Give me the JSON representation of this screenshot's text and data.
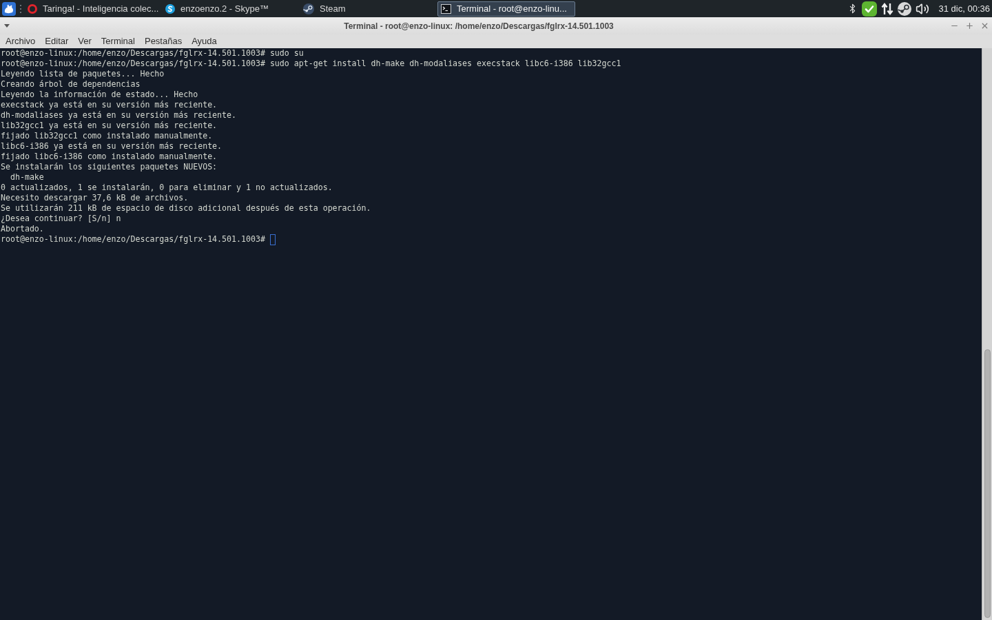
{
  "taskbar": {
    "windows": [
      {
        "label": "Taringa! - Inteligencia colec...",
        "selected": false
      },
      {
        "label": "enzoenzo.2 - Skype™",
        "selected": false
      },
      {
        "label": "Steam",
        "selected": false
      },
      {
        "label": "Terminal - root@enzo-linu...",
        "selected": true
      }
    ],
    "clock": "31 dic, 00:36"
  },
  "window": {
    "title": "Terminal - root@enzo-linux: /home/enzo/Descargas/fglrx-14.501.1003",
    "menu": [
      "Archivo",
      "Editar",
      "Ver",
      "Terminal",
      "Pestañas",
      "Ayuda"
    ]
  },
  "terminal": {
    "lines": [
      "root@enzo-linux:/home/enzo/Descargas/fglrx-14.501.1003# sudo su",
      "root@enzo-linux:/home/enzo/Descargas/fglrx-14.501.1003# sudo apt-get install dh-make dh-modaliases execstack libc6-i386 lib32gcc1",
      "Leyendo lista de paquetes... Hecho",
      "Creando árbol de dependencias",
      "Leyendo la información de estado... Hecho",
      "execstack ya está en su versión más reciente.",
      "dh-modaliases ya está en su versión más reciente.",
      "lib32gcc1 ya está en su versión más reciente.",
      "fijado lib32gcc1 como instalado manualmente.",
      "libc6-i386 ya está en su versión más reciente.",
      "fijado libc6-i386 como instalado manualmente.",
      "Se instalarán los siguientes paquetes NUEVOS:",
      "  dh-make",
      "0 actualizados, 1 se instalarán, 0 para eliminar y 1 no actualizados.",
      "Necesito descargar 37,6 kB de archivos.",
      "Se utilizarán 211 kB de espacio de disco adicional después de esta operación.",
      "¿Desea continuar? [S/n] n",
      "Abortado."
    ],
    "prompt": "root@enzo-linux:/home/enzo/Descargas/fglrx-14.501.1003#"
  }
}
